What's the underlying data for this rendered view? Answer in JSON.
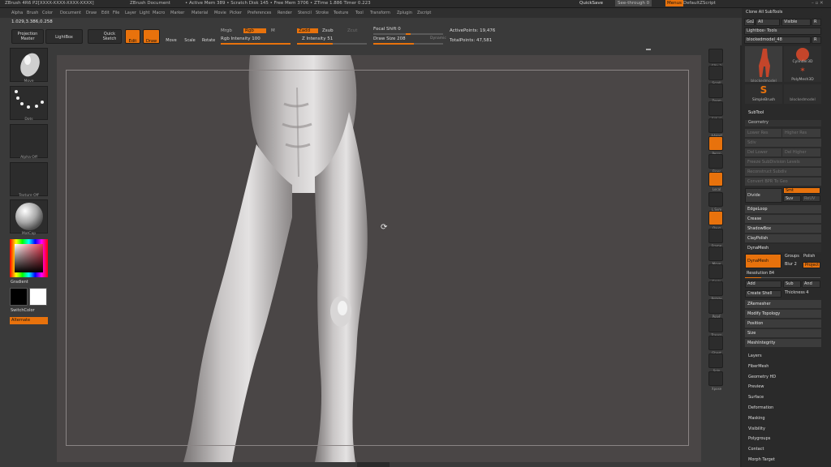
{
  "titlebar": {
    "app": "ZBrush 4R6 P2[XXXX-XXXX-XXXX-XXXX]",
    "doc": "ZBrush Document",
    "stats": "• Active Mem 389 • Scratch Disk 145 • Free Mem 3706 • ZTime 1.886 Timer 0.223",
    "quicksave": "QuickSave",
    "seethrough": "See-through 0",
    "menus": "Menus",
    "defaultzscript": "DefaultZScript"
  },
  "menubar": [
    "Alpha",
    "Brush",
    "Color",
    "Document",
    "Draw",
    "Edit",
    "File",
    "Layer",
    "Light",
    "Macro",
    "Marker",
    "Material",
    "Movie",
    "Picker",
    "Preferences",
    "Render",
    "Stencil",
    "Stroke",
    "Texture",
    "Tool",
    "Transform",
    "Zplugin",
    "Zscript"
  ],
  "toolrow": {
    "coords": "1.029,3.386,0.258",
    "projection_master": "Projection Master",
    "lightbox": "LightBox",
    "quick_sketch": "Quick Sketch",
    "edit": "Edit",
    "draw": "Draw",
    "move": "Move",
    "scale": "Scale",
    "rotate": "Rotate",
    "mrgb": "Mrgb",
    "rgb": "Rgb",
    "m": "M",
    "rgb_intensity": "Rgb Intensity 100",
    "zadd": "Zadd",
    "zsub": "Zsub",
    "zcut": "Zcut",
    "z_intensity": "Z Intensity 51",
    "focal_shift": "Focal Shift 0",
    "draw_size": "Draw Size 208",
    "dynamic": "Dynamic",
    "active_points": "ActivePoints: 19,476",
    "total_points": "TotalPoints: 47,581"
  },
  "leftshelf": {
    "items": [
      "Move",
      "Dots",
      "Alpha Off",
      "Texture Off",
      "MatCap"
    ],
    "gradient": "Gradient",
    "switchcolor": "SwitchColor",
    "alternate": "Alternate"
  },
  "rightshelf": [
    "SPix 3",
    "Scroll",
    "Zoom",
    "Actual",
    "AAHalf",
    "Persp",
    "Floor",
    "Local",
    "L.Sym",
    "Qxyz",
    "Frame",
    "Move",
    "Scale",
    "Rotate",
    "PolyF",
    "Transp",
    "Ghost",
    "Solo",
    "Xpose"
  ],
  "palette": {
    "clone_all": "Clone All SubTools",
    "goz": "GoZ",
    "all": "All",
    "visible": "Visible",
    "r": "R",
    "lightbox_tools": "Lightbox› Tools",
    "current_tool": "blockedmodel_48",
    "tools": [
      "blockedmodel",
      "Cylinder3D",
      "PolyMesh3D",
      "SimpleBrush",
      "blockedmodel"
    ],
    "subtool": "SubTool",
    "geometry": "Geometry",
    "geo_rows": [
      "Lower Res",
      "Higher Res",
      "Sdiv",
      "Del Lower",
      "Del Higher",
      "Freeze SubDivision Levels",
      "Reconstruct Subdiv",
      "Convert BPR To Geo"
    ],
    "divide": "Divide",
    "smt": "Smt",
    "suv": "Suv",
    "reuv": "ReUV",
    "edgeloop": "EdgeLoop",
    "crease": "Crease",
    "shadowbox": "ShadowBox",
    "claypolish": "ClayPolish",
    "dynamesh_header": "DynaMesh",
    "dynamesh": "DynaMesh",
    "groups": "Groups",
    "polish": "Polish",
    "blur": "Blur 2",
    "project": "Project",
    "resolution": "Resolution 84",
    "add": "Add",
    "sub": "Sub",
    "and": "And",
    "create_shell": "Create Shell",
    "thickness": "Thickness 4",
    "zremesher": "ZRemesher",
    "modify_topology": "Modify Topology",
    "position": "Position",
    "size": "Size",
    "meshintegrity": "MeshIntegrity",
    "menus": [
      "Layers",
      "FiberMesh",
      "Geometry HD",
      "Preview",
      "Surface",
      "Deformation",
      "Masking",
      "Visibility",
      "Polygroups",
      "Contact",
      "Morph Target"
    ]
  },
  "colors": {
    "accent": "#e8720c",
    "canvas": "#4a4646",
    "panel": "#3a3a3a"
  }
}
